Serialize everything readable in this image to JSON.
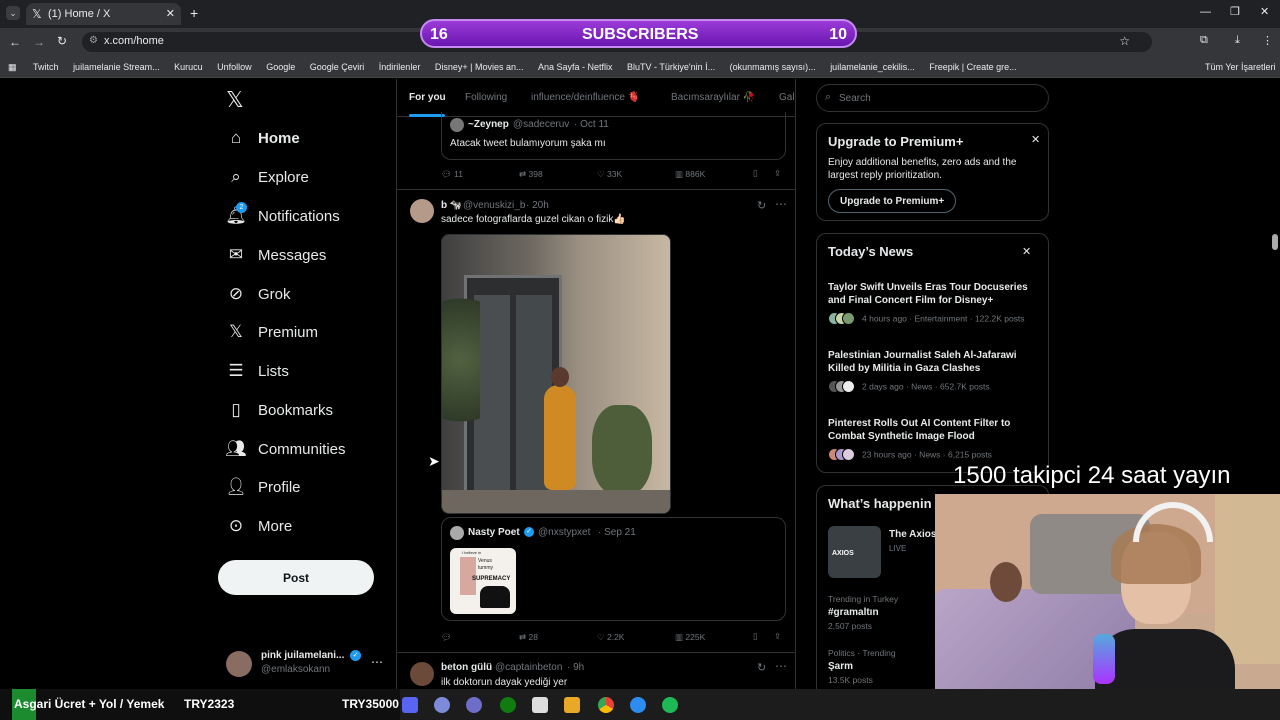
{
  "browser": {
    "tab_title": "(1) Home / X",
    "url": "x.com/home",
    "bookmarks": [
      "Twitch",
      "juilamelanie Stream...",
      "Kurucu",
      "Unfollow",
      "Google",
      "Google Çeviri",
      "İndirilenler",
      "Disney+ | Movies an...",
      "Ana Sayfa - Netflix",
      "BluTV - Türkiye'nin İ...",
      "(okunmamış sayısı)...",
      "juilamelanie_cekilis...",
      "Freepik | Create gre..."
    ],
    "other_bookmarks": "Tüm Yer İşaretleri"
  },
  "stream_banner": {
    "left_count": "16",
    "label": "SUBSCRIBERS",
    "right_count": "10"
  },
  "sidebar": {
    "items": [
      {
        "label": "Home"
      },
      {
        "label": "Explore"
      },
      {
        "label": "Notifications",
        "badge": "2"
      },
      {
        "label": "Messages"
      },
      {
        "label": "Grok"
      },
      {
        "label": "Premium"
      },
      {
        "label": "Lists"
      },
      {
        "label": "Bookmarks"
      },
      {
        "label": "Communities"
      },
      {
        "label": "Profile"
      },
      {
        "label": "More"
      }
    ],
    "post_label": "Post",
    "account": {
      "name": "pink juilamelani...",
      "handle": "@emlaksokann"
    }
  },
  "timeline": {
    "tabs": [
      "For you",
      "Following",
      "influence/deinfluence 🫀",
      "Bacımsaraylılar 🥀",
      "Gala"
    ],
    "quote_top": {
      "name": "~Zeynep",
      "handle": "@sadeceruv",
      "date": "· Oct 11",
      "text": "Atacak tweet bulamıyorum şaka mı"
    },
    "post1_stats": {
      "replies": "11",
      "reposts": "398",
      "likes": "33K",
      "views": "886K"
    },
    "post2": {
      "name": "b 🐄",
      "handle": "@venuskizi_b",
      "time": "· 20h",
      "text": "sadece fotograflarda guzel cikan o fizik👍🏻",
      "quote": {
        "name": "Nasty Poet",
        "handle": "@nxstypxet",
        "date": "· Sep 21",
        "meme_lines": [
          "I believe in",
          "Venus",
          "tummy",
          "SUPREMACY"
        ]
      },
      "stats": {
        "reposts": "28",
        "likes": "2.2K",
        "views": "225K"
      }
    },
    "post3": {
      "name": "beton gülü",
      "handle": "@captainbeton",
      "time": "· 9h",
      "text": "ilk doktorun dayak yediği yer"
    }
  },
  "right": {
    "search_placeholder": "Search",
    "premium": {
      "title": "Upgrade to Premium+",
      "body": "Enjoy additional benefits, zero ads and the largest reply prioritization.",
      "button": "Upgrade to Premium+"
    },
    "news": {
      "title": "Today’s News",
      "items": [
        {
          "headline": "Taylor Swift Unveils Eras Tour Docuseries and Final Concert Film for Disney+",
          "meta": "4 hours ago · Entertainment · 122.2K posts"
        },
        {
          "headline": "Palestinian Journalist Saleh Al-Jafarawi Killed by Militia in Gaza Clashes",
          "meta": "2 days ago · News · 652.7K posts"
        },
        {
          "headline": "Pinterest Rolls Out AI Content Filter to Combat Synthetic Image Flood",
          "meta": "23 hours ago · News · 6,215 posts"
        }
      ]
    },
    "happening": {
      "title": "What’s happenin",
      "live_name": "The Axios",
      "live_label": "LIVE",
      "thumb_label": "AXIOS",
      "trends": [
        {
          "context": "Trending in Turkey",
          "name": "#gramaltın",
          "count": "2,507 posts"
        },
        {
          "context": "Politics · Trending",
          "name": "Şarm",
          "count": "13.5K posts"
        }
      ]
    }
  },
  "overlay": {
    "caption": "1500 takipci 24 saat yayın"
  },
  "ticker": {
    "label": "Asgari Ücret + Yol / Yemek",
    "value1": "TRY2323",
    "value2": "TRY35000"
  }
}
